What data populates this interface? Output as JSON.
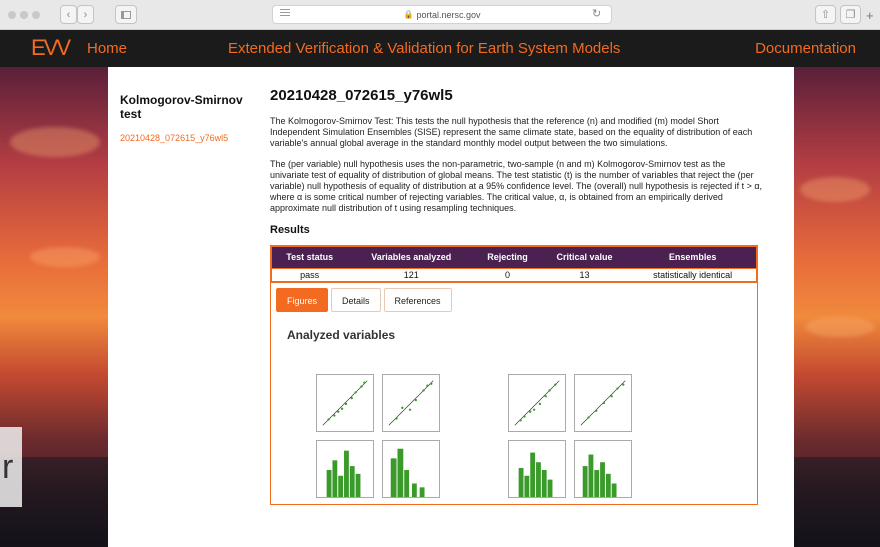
{
  "browser": {
    "url": "portal.nersc.gov"
  },
  "header": {
    "logo": "EVV",
    "home_label": "Home",
    "site_title": "Extended Verification & Validation for Earth System Models",
    "docs_label": "Documentation",
    "accent_color": "#f26b21"
  },
  "sidebar": {
    "title": "Kolmogorov-Smirnov test",
    "link": "20210428_072615_y76wl5"
  },
  "main": {
    "title": "20210428_072615_y76wl5",
    "para1": "The Kolmogorov-Smirnov Test: This tests the null hypothesis that the reference (n) and modified (m) model Short Independent Simulation Ensembles (SISE) represent the same climate state, based on the equality of distribution of each variable's annual global average in the standard monthly model output between the two simulations.",
    "para2": "The (per variable) null hypothesis uses the non-parametric, two-sample (n and m) Kolmogorov-Smirnov test as the univariate test of equality of distribution of global means. The test statistic (t) is the number of variables that reject the (per variable) null hypothesis of equality of distribution at a 95% confidence level. The (overall) null hypothesis is rejected if t > α, where α is some critical number of rejecting variables. The critical value, α, is obtained from an empirically derived approximate null distribution of t using resampling techniques.",
    "results_heading": "Results"
  },
  "results_table": {
    "headers": [
      "Test status",
      "Variables analyzed",
      "Rejecting",
      "Critical value",
      "Ensembles"
    ],
    "row": [
      "pass",
      "121",
      "0",
      "13",
      "statistically identical"
    ],
    "header_color": "#4a2150"
  },
  "tabs": {
    "items": [
      "Figures",
      "Details",
      "References"
    ],
    "active": "Figures"
  },
  "figures": {
    "heading": "Analyzed variables",
    "bar_color": "#3a9a2a"
  }
}
